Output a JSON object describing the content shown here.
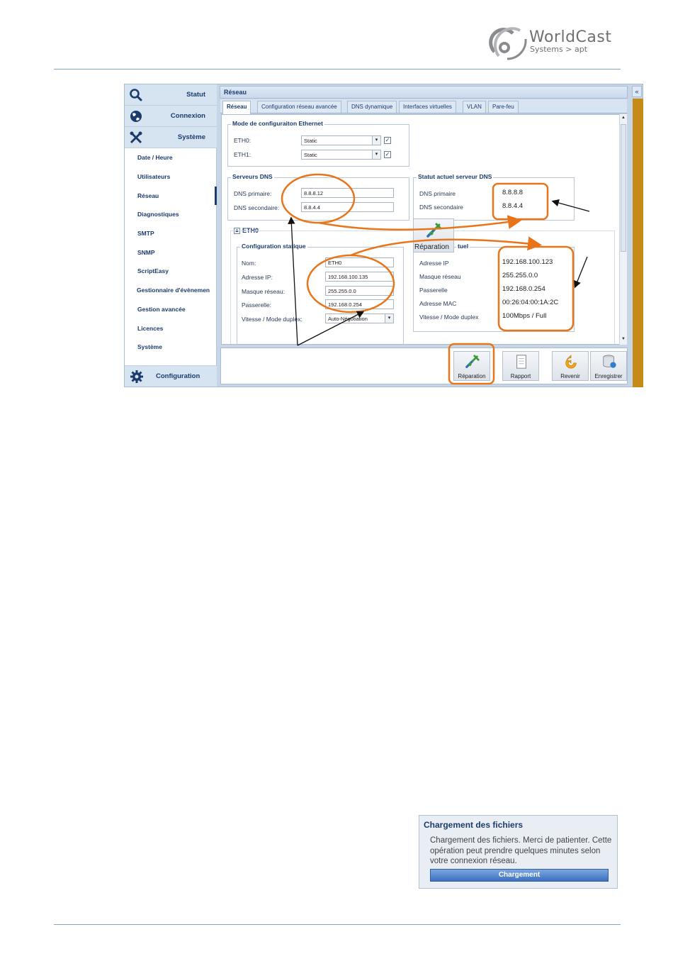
{
  "logo": {
    "brand": "WorldCast",
    "subline": "Systems",
    "arrow": ">",
    "sub_brand": "apt"
  },
  "sidebar": {
    "sections": [
      {
        "label": "Statut",
        "icon": "search-icon"
      },
      {
        "label": "Connexion",
        "icon": "globe-icon"
      },
      {
        "label": "Système",
        "icon": "tools-icon"
      }
    ],
    "items": [
      "Date / Heure",
      "Utilisateurs",
      "Réseau",
      "Diagnostiques",
      "SMTP",
      "SNMP",
      "ScriptEasy",
      "Gestionnaire d'évènemen",
      "Gestion avancée",
      "Licences",
      "Système"
    ],
    "bottom": {
      "label": "Configuration",
      "icon": "gear-icon"
    }
  },
  "main": {
    "title": "Réseau",
    "collapse": "«",
    "tabs": [
      "Réseau",
      "Configuration réseau avancée",
      "DNS dynamique",
      "Interfaces virtuelles",
      "VLAN",
      "Pare-feu"
    ]
  },
  "ethernet": {
    "legend": "Mode de configuraiton Ethernet",
    "eth0_label": "ETH0:",
    "eth0_value": "Static",
    "eth1_label": "ETH1:",
    "eth1_value": "Static",
    "check": "✓"
  },
  "dns": {
    "legend": "Serveurs DNS",
    "primary_label": "DNS primaire:",
    "primary_value": "8.8.8.12",
    "secondary_label": "DNS secondaire:",
    "secondary_value": "8.8.4.4"
  },
  "dns_status": {
    "legend": "Statut actuel serveur DNS",
    "primary_label": "DNS primaire",
    "primary_value": "8.8.8.8",
    "secondary_label": "DNS secondaire",
    "secondary_value": "8.8.4.4"
  },
  "eth0": {
    "header": "ETH0",
    "toggle": "▲",
    "static_legend": "Configuration statique",
    "name_label": "Nom:",
    "name_value": "ETH0",
    "ip_label": "Adresse IP:",
    "ip_value": "192.168.100.135",
    "mask_label": "Masque réseau:",
    "mask_value": "255.255.0.0",
    "gw_label": "Passerelle:",
    "gw_value": "192.168.0.254",
    "speed_label": "Vitesse / Mode duplex:",
    "speed_value": "Auto-Négotiation",
    "status_legend_tail": "tuel",
    "status": {
      "ip_label": "Adresse IP",
      "ip_value": "192.168.100.123",
      "mask_label": "Masque réseau",
      "mask_value": "255.255.0.0",
      "gw_label": "Passerelle",
      "gw_value": "192.168.0.254",
      "mac_label": "Adresse MAC",
      "mac_value": "00:26:04:00:1A:2C",
      "speed_label": "Vitesse / Mode duplex",
      "speed_value": "100Mbps / Full"
    }
  },
  "repair_popup": {
    "label": "Réparation"
  },
  "toolbar": {
    "repair": "Réparation",
    "report": "Rapport",
    "revert": "Revenir",
    "save": "Enregistrer"
  },
  "loading_dialog": {
    "title": "Chargement des fichiers",
    "message": "Chargement des fichiers. Merci de patienter. Cette opération peut prendre quelques minutes selon votre connexion réseau.",
    "button": "Chargement"
  },
  "colors": {
    "accent": "#1c3b6d",
    "annotation": "#e8751a",
    "brand_gray": "#6f7073"
  }
}
